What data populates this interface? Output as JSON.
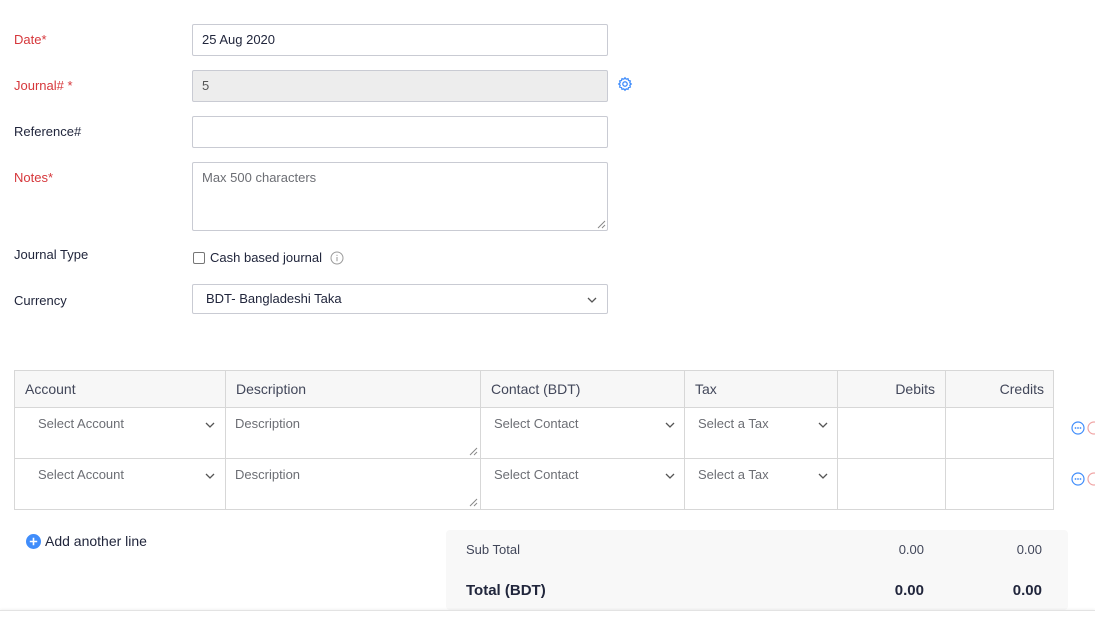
{
  "form": {
    "date": {
      "label": "Date*",
      "value": "25 Aug 2020"
    },
    "journal_no": {
      "label": "Journal# *",
      "value": "5"
    },
    "reference": {
      "label": "Reference#",
      "value": ""
    },
    "notes": {
      "label": "Notes*",
      "placeholder": "Max 500 characters"
    },
    "journal_type": {
      "label": "Journal Type",
      "checkbox_label": "Cash based journal",
      "checked": false
    },
    "currency": {
      "label": "Currency",
      "value": "BDT- Bangladeshi Taka"
    }
  },
  "table": {
    "headers": {
      "account": "Account",
      "description": "Description",
      "contact": "Contact (BDT)",
      "tax": "Tax",
      "debits": "Debits",
      "credits": "Credits"
    },
    "rows": [
      {
        "account": "Select Account",
        "description": "Description",
        "contact": "Select Contact",
        "tax": "Select a Tax",
        "debit": "",
        "credit": ""
      },
      {
        "account": "Select Account",
        "description": "Description",
        "contact": "Select Contact",
        "tax": "Select a Tax",
        "debit": "",
        "credit": ""
      }
    ]
  },
  "add_line_label": "Add another line",
  "totals": {
    "sub_total_label": "Sub Total",
    "sub_total_debit": "0.00",
    "sub_total_credit": "0.00",
    "total_label": "Total (BDT)",
    "total_debit": "0.00",
    "total_credit": "0.00"
  },
  "colors": {
    "required": "#d6373b",
    "accent": "#408dfb"
  }
}
